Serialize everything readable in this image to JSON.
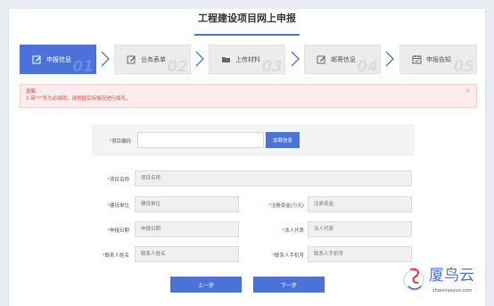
{
  "page": {
    "title": "工程建设项目网上申报"
  },
  "steps": [
    {
      "label": "申报信息",
      "num": "01",
      "icon": "edit-icon",
      "active": true
    },
    {
      "label": "业务表单",
      "num": "02",
      "icon": "edit-icon",
      "active": false
    },
    {
      "label": "上传材料",
      "num": "03",
      "icon": "folder-icon",
      "active": false
    },
    {
      "label": "邮寄信息",
      "num": "04",
      "icon": "edit-icon",
      "active": false
    },
    {
      "label": "申报告知",
      "num": "05",
      "icon": "calendar-icon",
      "active": false
    }
  ],
  "alert": {
    "title": "提醒:",
    "message": "1.带\"*\"号为必填项，请根据实际情况进行填写。",
    "close": "×"
  },
  "project_code": {
    "label": "项目编码",
    "value": "",
    "placeholder": "",
    "button": "加载信息"
  },
  "form": {
    "project_name": {
      "label": "项目名称",
      "placeholder": "项目名称"
    },
    "build_unit": {
      "label": "建设单位",
      "placeholder": "建设单位"
    },
    "capital": {
      "label": "注册资金(万元)",
      "placeholder": "注册资金"
    },
    "apply_date": {
      "label": "申报日期",
      "placeholder": "申报日期"
    },
    "legal_rep": {
      "label": "法人代表",
      "placeholder": "法人代表"
    },
    "contact_name": {
      "label": "联系人姓名",
      "placeholder": "联系人姓名"
    },
    "contact_phone": {
      "label": "联系人手机号",
      "placeholder": "联系人手机号"
    }
  },
  "actions": {
    "prev": "上一步",
    "next": "下一步"
  },
  "watermark": {
    "text": "厦鸟云",
    "url": "shanniaoyun.com"
  },
  "colors": {
    "accent": "#4a72d9",
    "alert_bg": "#fdecec",
    "alert_text": "#e04a4a"
  }
}
